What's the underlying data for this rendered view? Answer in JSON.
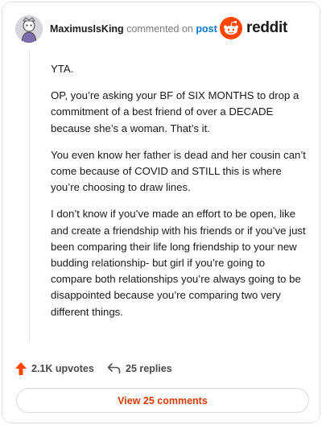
{
  "header": {
    "username": "MaximusIsKing",
    "commented_on": "commented on",
    "post_link": "post"
  },
  "brand": {
    "name": "reddit",
    "color": "#ff4500"
  },
  "comment": {
    "paragraphs": [
      "YTA.",
      "OP, you’re asking your BF of SIX MONTHS to drop a commitment of a best friend of over a DECADE because she’s a woman. That’s it.",
      "You even know her father is dead and her cousin can’t come because of COVID and STILL this is where you’re choosing to draw lines.",
      "I don’t know if you’ve made an effort to be open, like and create a friendship with his friends or if you’ve just been comparing their life long friendship to your new budding relationship- but girl if you’re going to compare both relationships you’re always going to be disappointed because you’re comparing two very different things."
    ]
  },
  "actions": {
    "upvotes": "2.1K upvotes",
    "replies": "25 replies",
    "upvote_color": "#ff4500"
  },
  "footer": {
    "view_label": "View 25 comments",
    "accent": "#d93a00"
  },
  "icons": [
    "avatar-icon",
    "reddit-logo-icon",
    "upvote-arrow-icon",
    "reply-arrow-icon"
  ]
}
